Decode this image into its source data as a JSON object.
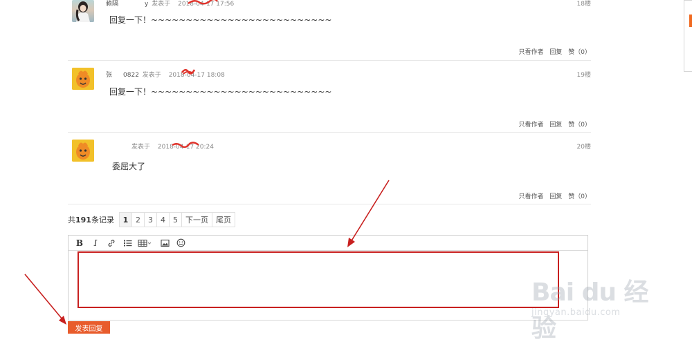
{
  "posts": [
    {
      "author": "赖隔",
      "author_suffix": "y",
      "posted_label": "发表于",
      "time": "2018-04-17 17:56",
      "floor": "18楼",
      "content": "回复一下！~~~~~~~~~~~~~~~~~~~~~~~~~~",
      "actions": {
        "author_only": "只看作者",
        "reply": "回复",
        "like": "赞（0）"
      }
    },
    {
      "author": "张",
      "author_suffix": "0822",
      "posted_label": "发表于",
      "time": "2018-04-17 18:08",
      "floor": "19楼",
      "content": "回复一下！~~~~~~~~~~~~~~~~~~~~~~~~~~",
      "actions": {
        "author_only": "只看作者",
        "reply": "回复",
        "like": "赞（0）"
      }
    },
    {
      "author": "",
      "author_suffix": "",
      "posted_label": "发表于",
      "time": "2018-04-17 20:24",
      "floor": "20楼",
      "content": "委屈大了",
      "actions": {
        "author_only": "只看作者",
        "reply": "回复",
        "like": "赞（0）"
      }
    }
  ],
  "pagination": {
    "total_prefix": "共",
    "total_count": "191",
    "total_suffix": "条记录",
    "pages": [
      "1",
      "2",
      "3",
      "4",
      "5"
    ],
    "current_page": "1",
    "next": "下一页",
    "last": "尾页"
  },
  "editor": {
    "toolbar": {
      "bold": "B",
      "italic": "I",
      "link_icon": "link-icon",
      "list_icon": "bulleted-list-icon",
      "table_icon": "table-icon",
      "image_icon": "image-icon",
      "emoji_icon": "emoji-icon"
    }
  },
  "submit_label": "发表回复",
  "watermark": {
    "main": "Bai du 经验",
    "sub": "jingyan.baidu.com"
  },
  "colors": {
    "annotation_red": "#c8201f",
    "submit_orange": "#e85c2c",
    "panel_orange": "#f06a21"
  }
}
